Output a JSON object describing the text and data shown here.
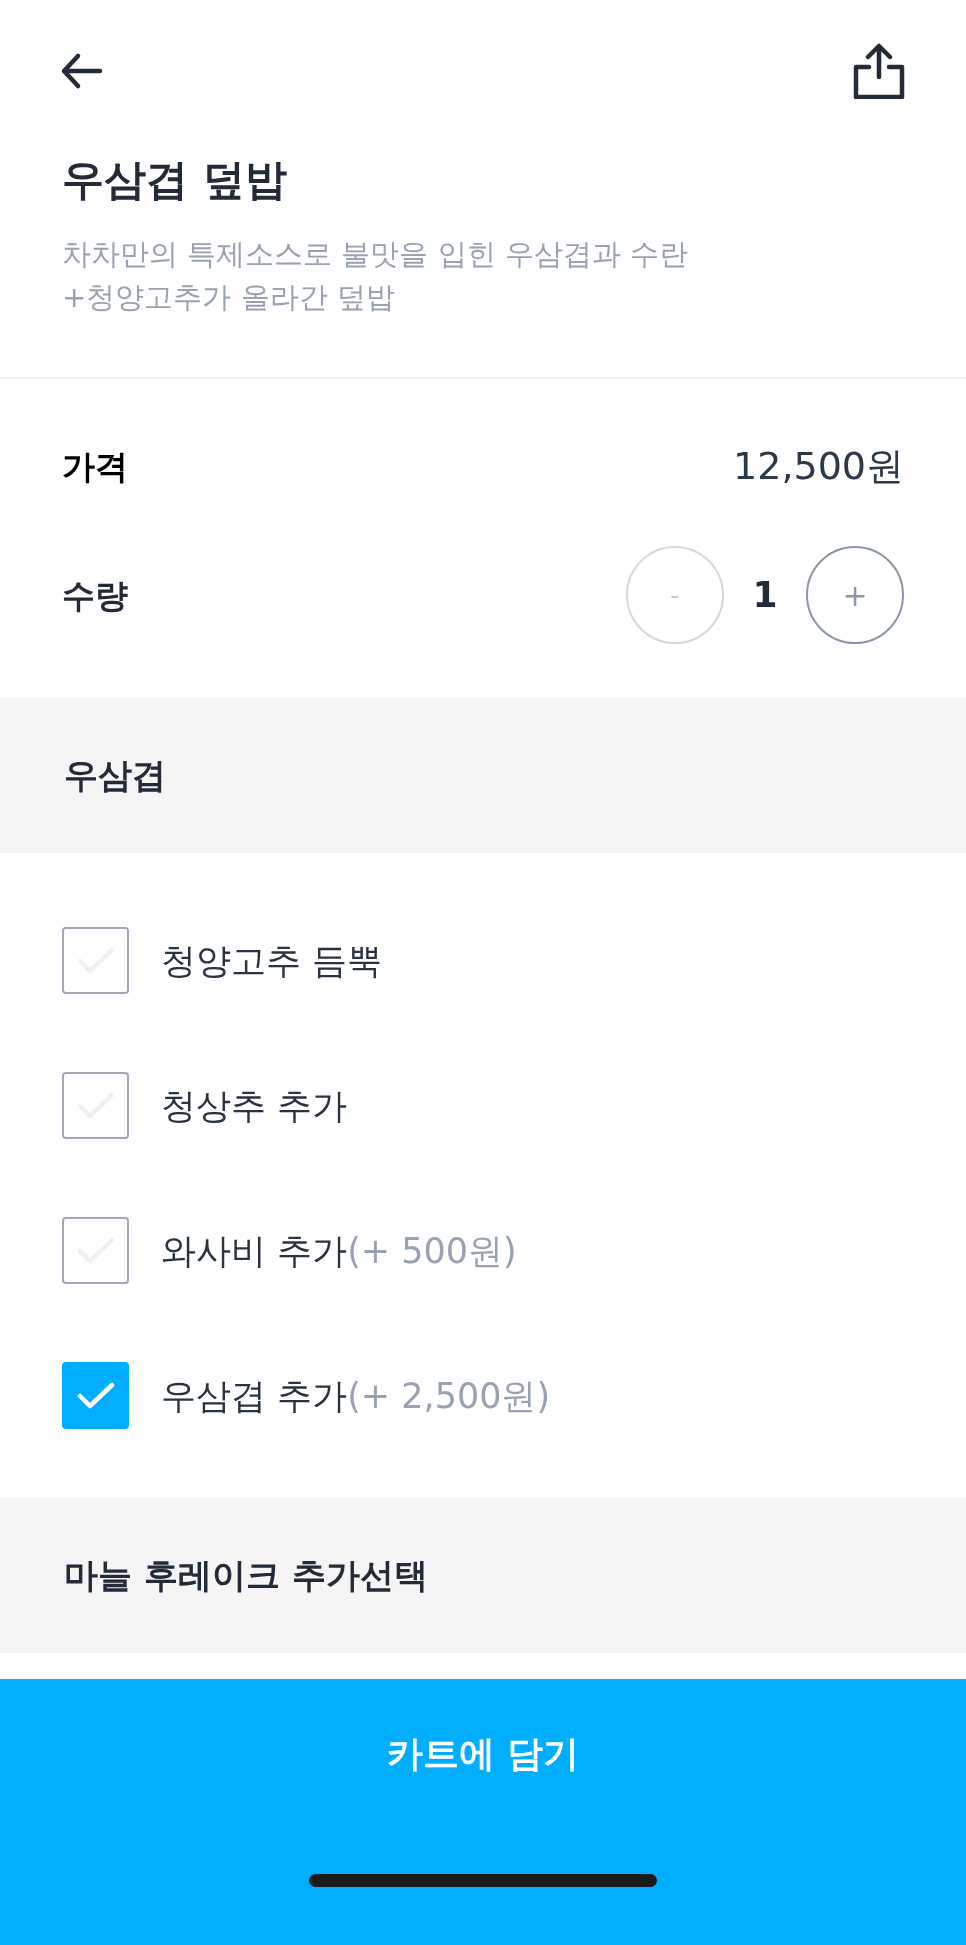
{
  "title": "우삼겹 덮밥",
  "description_lines": [
    "차차만의 특제소스로 불맛을 입힌 우삼겹과 수란",
    "+청양고추가 올라간 덮밥"
  ],
  "price": {
    "label": "가격",
    "value": "12,500원"
  },
  "quantity": {
    "label": "수량",
    "minus": "-",
    "value": "1",
    "plus": "+",
    "minus_disabled": true
  },
  "sections": [
    {
      "title": "우삼겹",
      "options": [
        {
          "label": "청양고추 듬뿍",
          "checked": false
        },
        {
          "label": "청상추 추가",
          "checked": false
        },
        {
          "label": "와사비 추가",
          "price": "(+ 500원)",
          "checked": false
        },
        {
          "label": "우삼겹 추가",
          "price": "(+ 2,500원)",
          "checked": true
        }
      ]
    },
    {
      "title": "마늘 후레이크 추가선택"
    }
  ],
  "cart_button": "카트에 담기"
}
